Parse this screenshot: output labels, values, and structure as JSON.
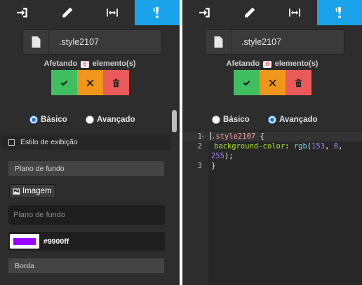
{
  "left_panel": {
    "toolbar": [
      {
        "icon": "sign-in-icon",
        "active": false
      },
      {
        "icon": "pencil-icon",
        "active": false
      },
      {
        "icon": "resize-horizontal-icon",
        "active": false
      },
      {
        "icon": "paint-bucket-icon",
        "active": true
      }
    ],
    "selector": ".style2107",
    "affecting": {
      "prefix": "Afetando",
      "count": "0",
      "suffix": "elemento(s)"
    },
    "mode": {
      "basic_label": "Básico",
      "advanced_label": "Avançado",
      "selected": "basic"
    },
    "display_style_label": "Estilo de exibição",
    "background": {
      "section_title": "Plano de fundo",
      "image_button_label": "Imagem",
      "input_placeholder": "Plano de fundo",
      "color_value": "#9900ff",
      "swatch_color": "#9900ff"
    },
    "border_section_title": "Borda"
  },
  "right_panel": {
    "toolbar": [
      {
        "icon": "sign-in-icon",
        "active": false
      },
      {
        "icon": "pencil-icon",
        "active": false
      },
      {
        "icon": "resize-horizontal-icon",
        "active": false
      },
      {
        "icon": "paint-bucket-icon",
        "active": true
      }
    ],
    "selector": ".style2107",
    "affecting": {
      "prefix": "Afetando",
      "count": "0",
      "suffix": "elemento(s)"
    },
    "mode": {
      "basic_label": "Básico",
      "advanced_label": "Avançado",
      "selected": "advanced"
    },
    "code": {
      "line_numbers": [
        "1",
        "2",
        "3"
      ],
      "selector": ".style2107",
      "open_brace": " {",
      "property": "background-color",
      "colon": ": ",
      "func": "rgb",
      "args_open": "(",
      "r": "153",
      "g": "0",
      "b": "255",
      "args_close": ");",
      "close_brace": "}"
    }
  },
  "colors": {
    "accent": "#1aa3e8",
    "ok": "#3fbf5f",
    "cancel": "#f0961a",
    "delete": "#ea5a5a"
  }
}
